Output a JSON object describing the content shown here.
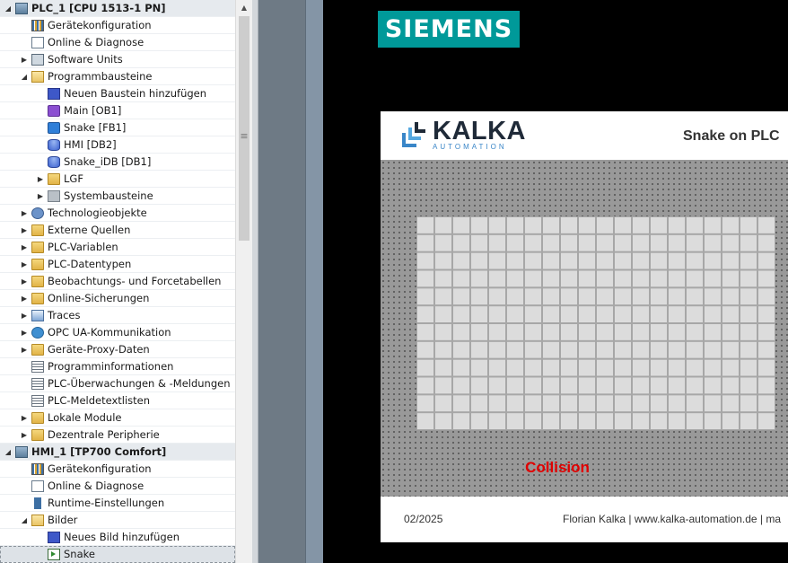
{
  "tree": {
    "rows": [
      {
        "label": "PLC_1 [CPU 1513-1 PN]",
        "icon": "plc-icon",
        "indent": 0,
        "toggle": "expanded",
        "group": true
      },
      {
        "label": "Gerätekonfiguration",
        "icon": "device-config-icon",
        "indent": 1,
        "toggle": "none"
      },
      {
        "label": "Online & Diagnose",
        "icon": "online-diagnostics-icon",
        "indent": 1,
        "toggle": "none"
      },
      {
        "label": "Software Units",
        "icon": "software-units-icon",
        "indent": 1,
        "toggle": "collapsed"
      },
      {
        "label": "Programmbausteine",
        "icon": "folder-open-icon",
        "indent": 1,
        "toggle": "expanded"
      },
      {
        "label": "Neuen Baustein hinzufügen",
        "icon": "add-block-icon",
        "indent": 2,
        "toggle": "none"
      },
      {
        "label": "Main [OB1]",
        "icon": "ob-block-icon",
        "indent": 2,
        "toggle": "none"
      },
      {
        "label": "Snake [FB1]",
        "icon": "fb-block-icon",
        "indent": 2,
        "toggle": "none"
      },
      {
        "label": "HMI [DB2]",
        "icon": "db-block-icon",
        "indent": 2,
        "toggle": "none"
      },
      {
        "label": "Snake_iDB [DB1]",
        "icon": "db-block-icon",
        "indent": 2,
        "toggle": "none"
      },
      {
        "label": "LGF",
        "icon": "library-folder-icon",
        "indent": 2,
        "toggle": "collapsed"
      },
      {
        "label": "Systembausteine",
        "icon": "system-blocks-icon",
        "indent": 2,
        "toggle": "collapsed"
      },
      {
        "label": "Technologieobjekte",
        "icon": "technology-objects-icon",
        "indent": 1,
        "toggle": "collapsed"
      },
      {
        "label": "Externe Quellen",
        "icon": "external-sources-icon",
        "indent": 1,
        "toggle": "collapsed"
      },
      {
        "label": "PLC-Variablen",
        "icon": "plc-tags-icon",
        "indent": 1,
        "toggle": "collapsed"
      },
      {
        "label": "PLC-Datentypen",
        "icon": "plc-datatypes-icon",
        "indent": 1,
        "toggle": "collapsed"
      },
      {
        "label": "Beobachtungs- und Forcetabellen",
        "icon": "watch-tables-icon",
        "indent": 1,
        "toggle": "collapsed"
      },
      {
        "label": "Online-Sicherungen",
        "icon": "online-backups-icon",
        "indent": 1,
        "toggle": "collapsed"
      },
      {
        "label": "Traces",
        "icon": "traces-icon",
        "indent": 1,
        "toggle": "collapsed"
      },
      {
        "label": "OPC UA-Kommunikation",
        "icon": "opc-ua-icon",
        "indent": 1,
        "toggle": "collapsed"
      },
      {
        "label": "Geräte-Proxy-Daten",
        "icon": "device-proxy-icon",
        "indent": 1,
        "toggle": "collapsed"
      },
      {
        "label": "Programminformationen",
        "icon": "program-info-icon",
        "indent": 1,
        "toggle": "none"
      },
      {
        "label": "PLC-Überwachungen & -Meldungen",
        "icon": "plc-alarms-icon",
        "indent": 1,
        "toggle": "none"
      },
      {
        "label": "PLC-Meldetextlisten",
        "icon": "text-lists-icon",
        "indent": 1,
        "toggle": "none"
      },
      {
        "label": "Lokale Module",
        "icon": "local-modules-icon",
        "indent": 1,
        "toggle": "collapsed"
      },
      {
        "label": "Dezentrale Peripherie",
        "icon": "distributed-io-icon",
        "indent": 1,
        "toggle": "collapsed"
      },
      {
        "label": "HMI_1 [TP700 Comfort]",
        "icon": "hmi-device-icon",
        "indent": 0,
        "toggle": "expanded",
        "group": true
      },
      {
        "label": "Gerätekonfiguration",
        "icon": "device-config-icon",
        "indent": 1,
        "toggle": "none"
      },
      {
        "label": "Online & Diagnose",
        "icon": "online-diagnostics-icon",
        "indent": 1,
        "toggle": "none"
      },
      {
        "label": "Runtime-Einstellungen",
        "icon": "runtime-settings-icon",
        "indent": 1,
        "toggle": "none"
      },
      {
        "label": "Bilder",
        "icon": "folder-open-icon",
        "indent": 1,
        "toggle": "expanded"
      },
      {
        "label": "Neues Bild hinzufügen",
        "icon": "add-screen-icon",
        "indent": 2,
        "toggle": "none"
      },
      {
        "label": "Snake",
        "icon": "screen-icon",
        "indent": 2,
        "toggle": "none",
        "selected": true
      }
    ]
  },
  "scrollbar": {
    "up_arrow": "▲",
    "grip": "≡"
  },
  "hmi": {
    "brand": "SIEMENS",
    "company": "KALKA",
    "company_sub": "AUTOMATION",
    "title": "Snake on PLC",
    "status": "Collision",
    "footer_date": "02/2025",
    "footer_right": "Florian Kalka | www.kalka-automation.de | ma",
    "grid_cols": 20,
    "grid_rows": 12,
    "colors": {
      "brand": "#009999",
      "status": "#e00000",
      "cell": "#dcdcdc"
    }
  }
}
